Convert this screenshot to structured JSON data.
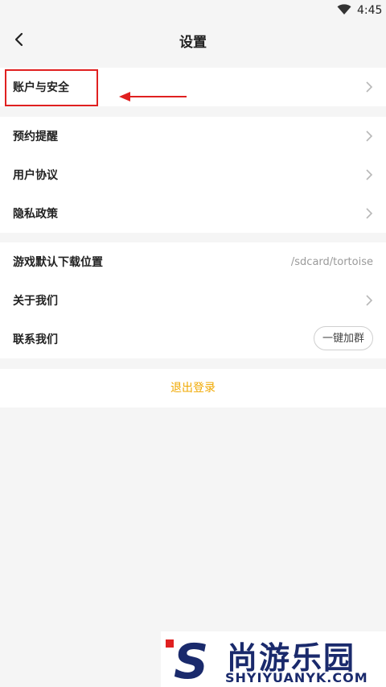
{
  "status_bar": {
    "time": "4:45",
    "wifi_icon": "wifi-icon"
  },
  "header": {
    "title": "设置",
    "back_icon": "chevron-left-icon"
  },
  "groups": [
    {
      "items": [
        {
          "label": "账户与安全",
          "trailing": "chevron-right-icon"
        }
      ]
    },
    {
      "items": [
        {
          "label": "预约提醒",
          "trailing": "chevron-right-icon"
        },
        {
          "label": "用户协议",
          "trailing": "chevron-right-icon"
        },
        {
          "label": "隐私政策",
          "trailing": "chevron-right-icon"
        }
      ]
    },
    {
      "items": [
        {
          "label": "游戏默认下载位置",
          "value": "/sdcard/tortoise"
        },
        {
          "label": "关于我们",
          "trailing": "chevron-right-icon"
        },
        {
          "label": "联系我们",
          "button": "一键加群"
        }
      ]
    }
  ],
  "logout_label": "退出登录",
  "annotation": {
    "color": "#e02020"
  },
  "watermark": {
    "name": "尚游乐园",
    "domain": "SHYIYUANYK.COM",
    "logo": "S"
  },
  "colors": {
    "accent": "#f0a800",
    "background": "#f5f5f5",
    "card": "#ffffff"
  }
}
